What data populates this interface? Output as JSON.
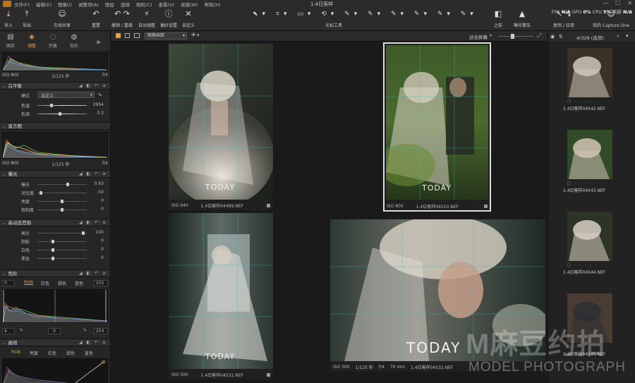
{
  "menu": {
    "items": [
      "文件(F)",
      "编辑(E)",
      "图像(I)",
      "调整项(A)",
      "图层",
      "选择",
      "相机(C)",
      "查看(V)",
      "视窗(W)",
      "帮助(H)"
    ],
    "title": "1.4日客样",
    "win_controls": [
      "—",
      "☐",
      "✕"
    ]
  },
  "toolbar": {
    "import": "导入",
    "export": "导出",
    "share": "在线共享",
    "reset": "重置",
    "undo_redo": "撤销 / 重做",
    "auto_adjust": "自动调整",
    "preferences": "偏好设置",
    "customize": "自定义",
    "cursor_tools": "光标工具",
    "before": "之前",
    "exposure_warning": "曝光警告",
    "copy_apply": "复制 / 应用",
    "brand": "我的 Capture One",
    "stats": {
      "fps_label": "FPS",
      "fps": "N/A",
      "gpu_label": "GPU",
      "gpu": "0%",
      "cpu_label": "CPU",
      "cpu": "5%",
      "refresh_label": "刷新",
      "refresh": "N/A"
    }
  },
  "left_panel": {
    "tabs": [
      {
        "label": "图库",
        "icon": "library-icon"
      },
      {
        "label": "调整",
        "icon": "adjust-icon"
      },
      {
        "label": "完善",
        "icon": "refine-icon"
      },
      {
        "label": "色彩",
        "icon": "color-icon"
      }
    ],
    "top_info": {
      "iso": "ISO 800",
      "shutter": "1/125 秒",
      "aperture": "f/4"
    },
    "white_balance": {
      "title": "白平衡",
      "mode_label": "模式",
      "mode_value": "自定义",
      "temp_label": "色温",
      "temp_value": "2954",
      "tint_label": "色调",
      "tint_value": "-3.3"
    },
    "histogram": {
      "title": "直方图",
      "iso": "ISO 800",
      "shutter": "1/125 秒",
      "aperture": "f/4"
    },
    "exposure": {
      "title": "曝光",
      "rows": [
        {
          "label": "曝光",
          "value": "0.63",
          "pos": 0.62
        },
        {
          "label": "对比度",
          "value": "-50",
          "pos": 0.05
        },
        {
          "label": "亮度",
          "value": "0",
          "pos": 0.5
        },
        {
          "label": "饱和度",
          "value": "0",
          "pos": 0.5
        }
      ]
    },
    "hdr": {
      "title": "高动态范围",
      "rows": [
        {
          "label": "高光",
          "value": "100",
          "pos": 0.95
        },
        {
          "label": "阴影",
          "value": "0",
          "pos": 0.3
        },
        {
          "label": "白色",
          "value": "0",
          "pos": 0.3
        },
        {
          "label": "黑色",
          "value": "0",
          "pos": 0.3
        }
      ]
    },
    "levels": {
      "title": "色阶",
      "min": "0",
      "max": "255",
      "channels": [
        "RGB",
        "红色",
        "绿色",
        "蓝色"
      ],
      "out_min": "4",
      "mid": "0",
      "out_max": "254"
    },
    "curve": {
      "title": "曲线",
      "channels": [
        "RGB",
        "亮度",
        "红色",
        "绿色",
        "蓝色"
      ]
    }
  },
  "viewer": {
    "zoom_select": "图像画面",
    "fit_label": "适合屏幕",
    "thumbs": [
      {
        "iso": "ISO 640",
        "shutter": "",
        "aperture": "",
        "focal": "",
        "name": "1.4日客样04499.NEF",
        "watermark": "TODAY"
      },
      {
        "iso": "ISO 800",
        "shutter": "",
        "aperture": "",
        "focal": "",
        "name": "1.4日客样04510.NEF",
        "watermark": "TODAY"
      },
      {
        "iso": "ISO 500",
        "shutter": "",
        "aperture": "",
        "focal": "",
        "name": "1.4日客样04531.NEF",
        "watermark": "TODAY"
      },
      {
        "iso": "ISO 500",
        "shutter": "1/125 秒",
        "aperture": "f/4",
        "focal": "70 mm",
        "name": "1.4日客样04532.NEF",
        "watermark": "TODAY"
      }
    ]
  },
  "filmstrip": {
    "count": "4/328 (选项)",
    "items": [
      {
        "name": "1.4日客样04542.NEF"
      },
      {
        "name": "1.4日客样04543.NEF"
      },
      {
        "name": "1.4日客样04544.NEF"
      },
      {
        "name": "1.4日客样04545.NEF"
      }
    ]
  },
  "watermark": {
    "main": "M麻豆约拍",
    "sub": "MODEL PHOTOGRAPH"
  }
}
